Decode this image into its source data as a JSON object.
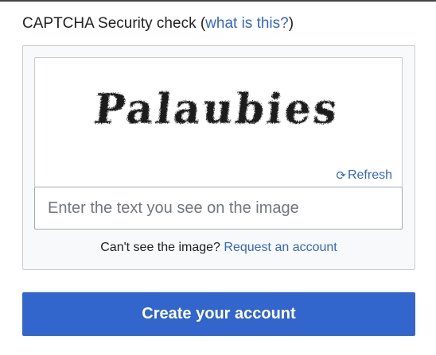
{
  "captcha": {
    "heading_text": "CAPTCHA Security check (",
    "heading_link": "what is this?",
    "heading_close": ")",
    "image_text": "Palaubies",
    "refresh_label": "Refresh",
    "input_placeholder": "Enter the text you see on the image",
    "input_value": "",
    "cant_see_text": "Can't see the image? ",
    "request_account_link": "Request an account"
  },
  "actions": {
    "create_account_label": "Create your account"
  },
  "colors": {
    "link": "#3366cc",
    "primary_button": "#3366cc",
    "panel_bg": "#f8f9fa",
    "border": "#c8ccd1"
  },
  "icons": {
    "refresh": "refresh-icon"
  }
}
